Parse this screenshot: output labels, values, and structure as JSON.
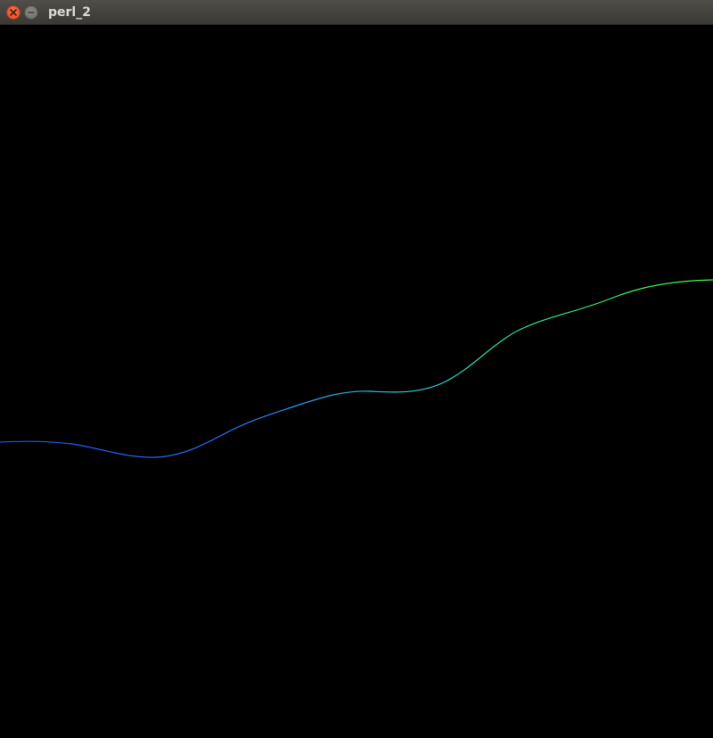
{
  "window": {
    "title": "perl_2",
    "buttons": {
      "close": "close-icon",
      "minimize": "minimize-icon"
    },
    "colors": {
      "titlebar": "#3c3b37",
      "close": "#e95420",
      "canvas_background": "#000000",
      "curve_start": "#1e4fff",
      "curve_end": "#3cff3c"
    }
  }
}
